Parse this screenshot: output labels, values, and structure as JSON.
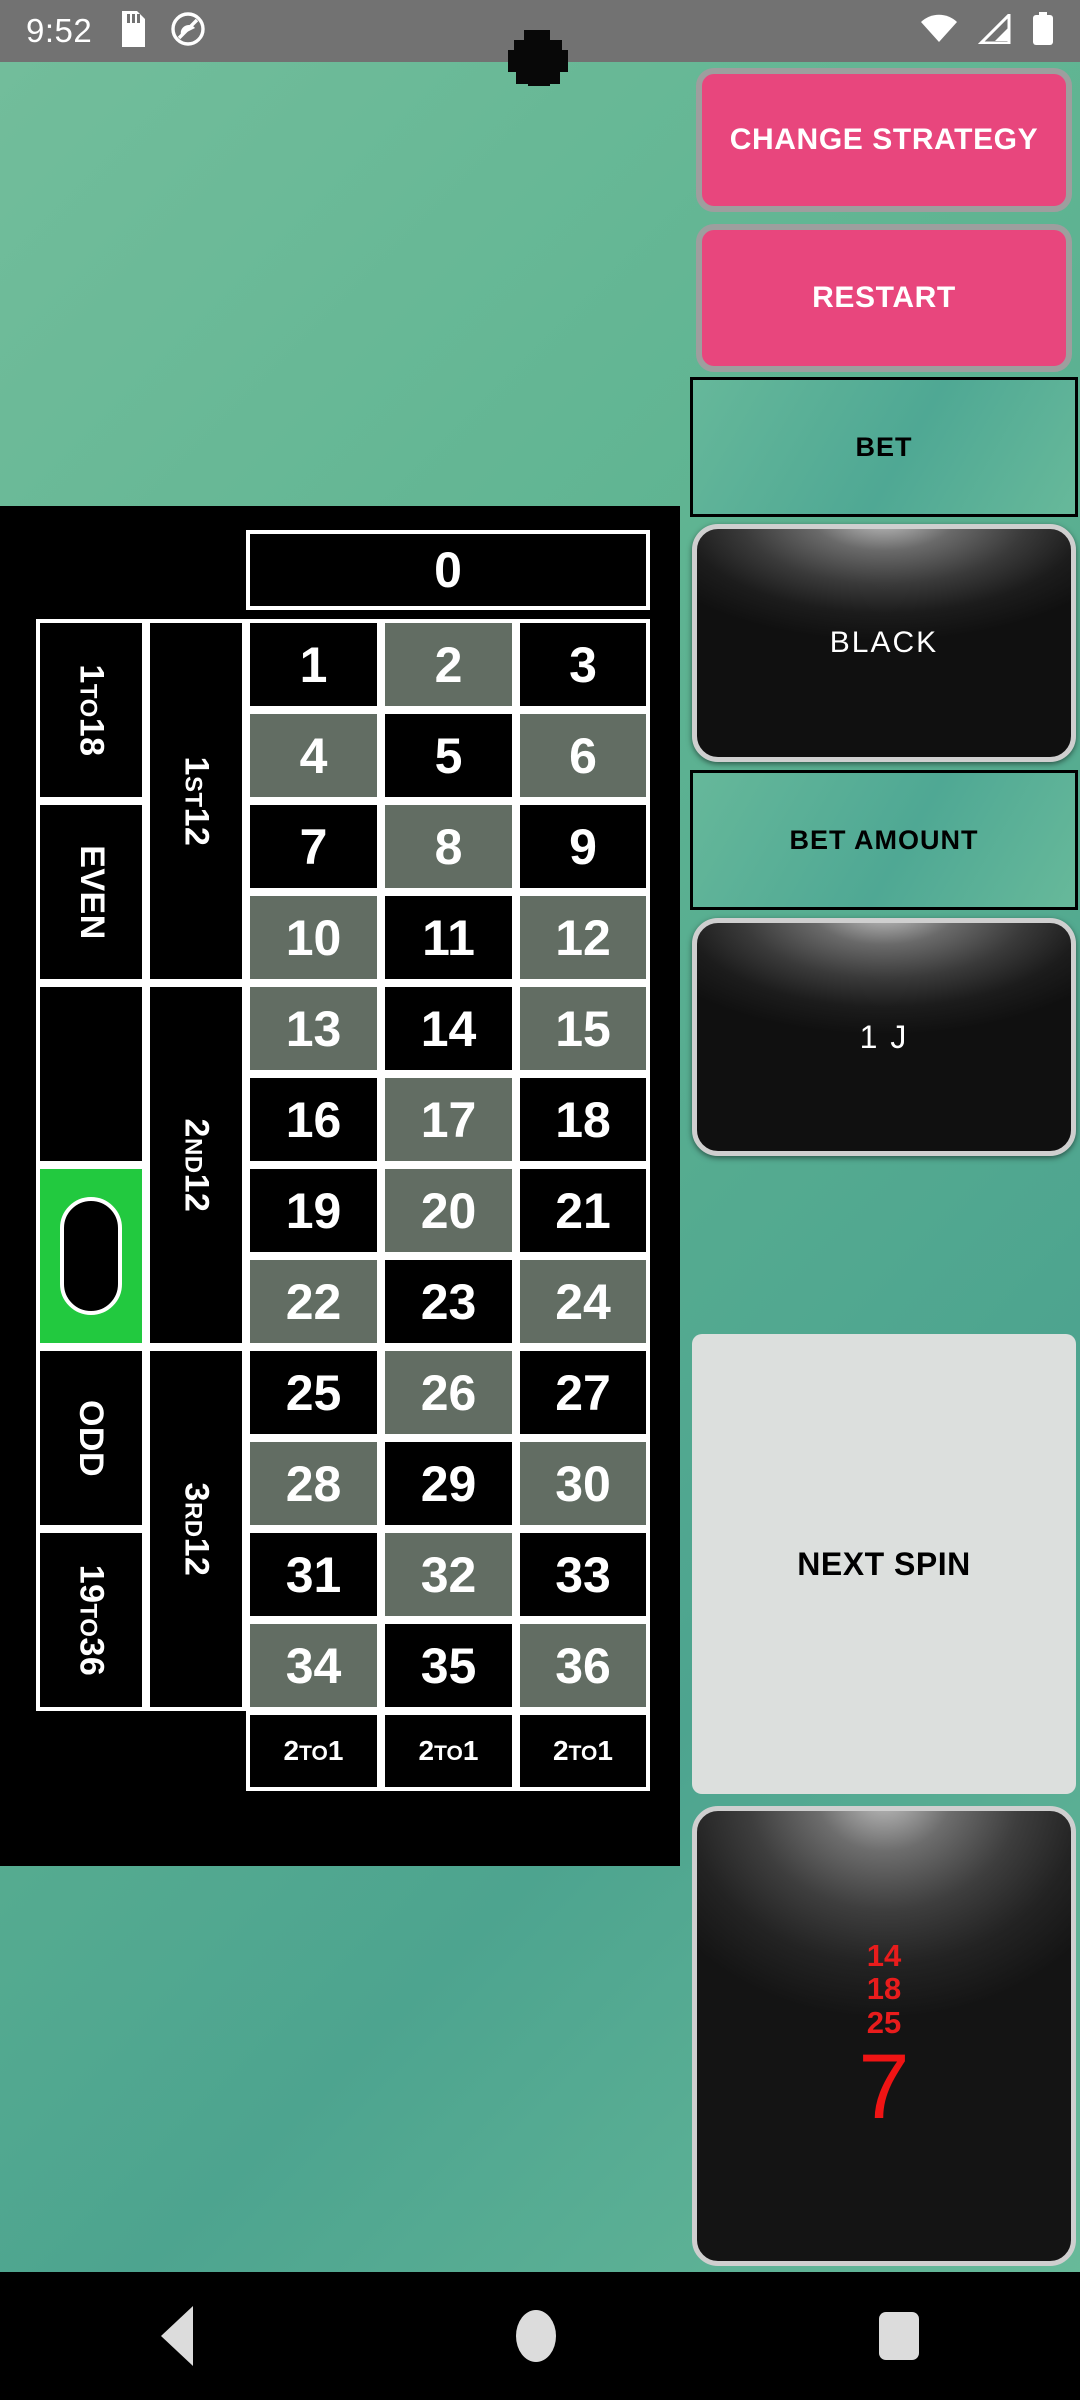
{
  "status_bar": {
    "time": "9:52",
    "left_icons": [
      "sd-card-icon",
      "do-not-disturb-icon"
    ],
    "right_icons": [
      "wifi-icon",
      "cellular-signal-icon",
      "battery-icon"
    ]
  },
  "colors": {
    "background_green": "#62b593",
    "accent_pink": "#e8467d",
    "red_number_cell": "#626d63",
    "black_number_cell": "#000000",
    "green_bet_marker": "#22c93f",
    "history_red": "#e81c1c",
    "next_spin_bg": "#dcdfdd"
  },
  "table": {
    "zero": "0",
    "numbers": [
      {
        "n": "1",
        "c": "black"
      },
      {
        "n": "2",
        "c": "red"
      },
      {
        "n": "3",
        "c": "black"
      },
      {
        "n": "4",
        "c": "red"
      },
      {
        "n": "5",
        "c": "black"
      },
      {
        "n": "6",
        "c": "red"
      },
      {
        "n": "7",
        "c": "black"
      },
      {
        "n": "8",
        "c": "red"
      },
      {
        "n": "9",
        "c": "black"
      },
      {
        "n": "10",
        "c": "red"
      },
      {
        "n": "11",
        "c": "black"
      },
      {
        "n": "12",
        "c": "red"
      },
      {
        "n": "13",
        "c": "red"
      },
      {
        "n": "14",
        "c": "black"
      },
      {
        "n": "15",
        "c": "red"
      },
      {
        "n": "16",
        "c": "black"
      },
      {
        "n": "17",
        "c": "red"
      },
      {
        "n": "18",
        "c": "black"
      },
      {
        "n": "19",
        "c": "black"
      },
      {
        "n": "20",
        "c": "red"
      },
      {
        "n": "21",
        "c": "black"
      },
      {
        "n": "22",
        "c": "red"
      },
      {
        "n": "23",
        "c": "black"
      },
      {
        "n": "24",
        "c": "red"
      },
      {
        "n": "25",
        "c": "black"
      },
      {
        "n": "26",
        "c": "red"
      },
      {
        "n": "27",
        "c": "black"
      },
      {
        "n": "28",
        "c": "red"
      },
      {
        "n": "29",
        "c": "black"
      },
      {
        "n": "30",
        "c": "red"
      },
      {
        "n": "31",
        "c": "black"
      },
      {
        "n": "32",
        "c": "red"
      },
      {
        "n": "33",
        "c": "black"
      },
      {
        "n": "34",
        "c": "red"
      },
      {
        "n": "35",
        "c": "black"
      },
      {
        "n": "36",
        "c": "red"
      }
    ],
    "outside_left": [
      {
        "label": "1TO18",
        "main": "1",
        "sc": "TO",
        "tail": "18"
      },
      {
        "label": "EVEN",
        "main": "EVEN",
        "sc": "",
        "tail": ""
      },
      {
        "label": "",
        "main": "",
        "sc": "",
        "tail": ""
      },
      {
        "label": "BLACK-MARKER",
        "main": "",
        "sc": "",
        "tail": ""
      },
      {
        "label": "ODD",
        "main": "ODD",
        "sc": "",
        "tail": ""
      },
      {
        "label": "19TO36",
        "main": "19",
        "sc": "TO",
        "tail": "36"
      }
    ],
    "dozens": [
      {
        "main": "1",
        "sc": "ST",
        "tail": "12"
      },
      {
        "main": "2",
        "sc": "ND",
        "tail": "12"
      },
      {
        "main": "3",
        "sc": "RD",
        "tail": "12"
      }
    ],
    "column_bets": [
      {
        "main": "2",
        "sc": "TO",
        "tail": "1"
      },
      {
        "main": "2",
        "sc": "TO",
        "tail": "1"
      },
      {
        "main": "2",
        "sc": "TO",
        "tail": "1"
      }
    ]
  },
  "panel": {
    "change_strategy": "CHANGE STRATEGY",
    "restart": "RESTART",
    "bet_label": "BET",
    "bet_value": "BLACK",
    "bet_amount_label": "BET AMOUNT",
    "bet_amount_value": "1  J",
    "next_spin": "NEXT SPIN"
  },
  "history": {
    "previous": [
      "14",
      "18",
      "25"
    ],
    "current": "7"
  },
  "nav_bar": {
    "items": [
      "back-icon",
      "home-icon",
      "recents-icon"
    ]
  }
}
